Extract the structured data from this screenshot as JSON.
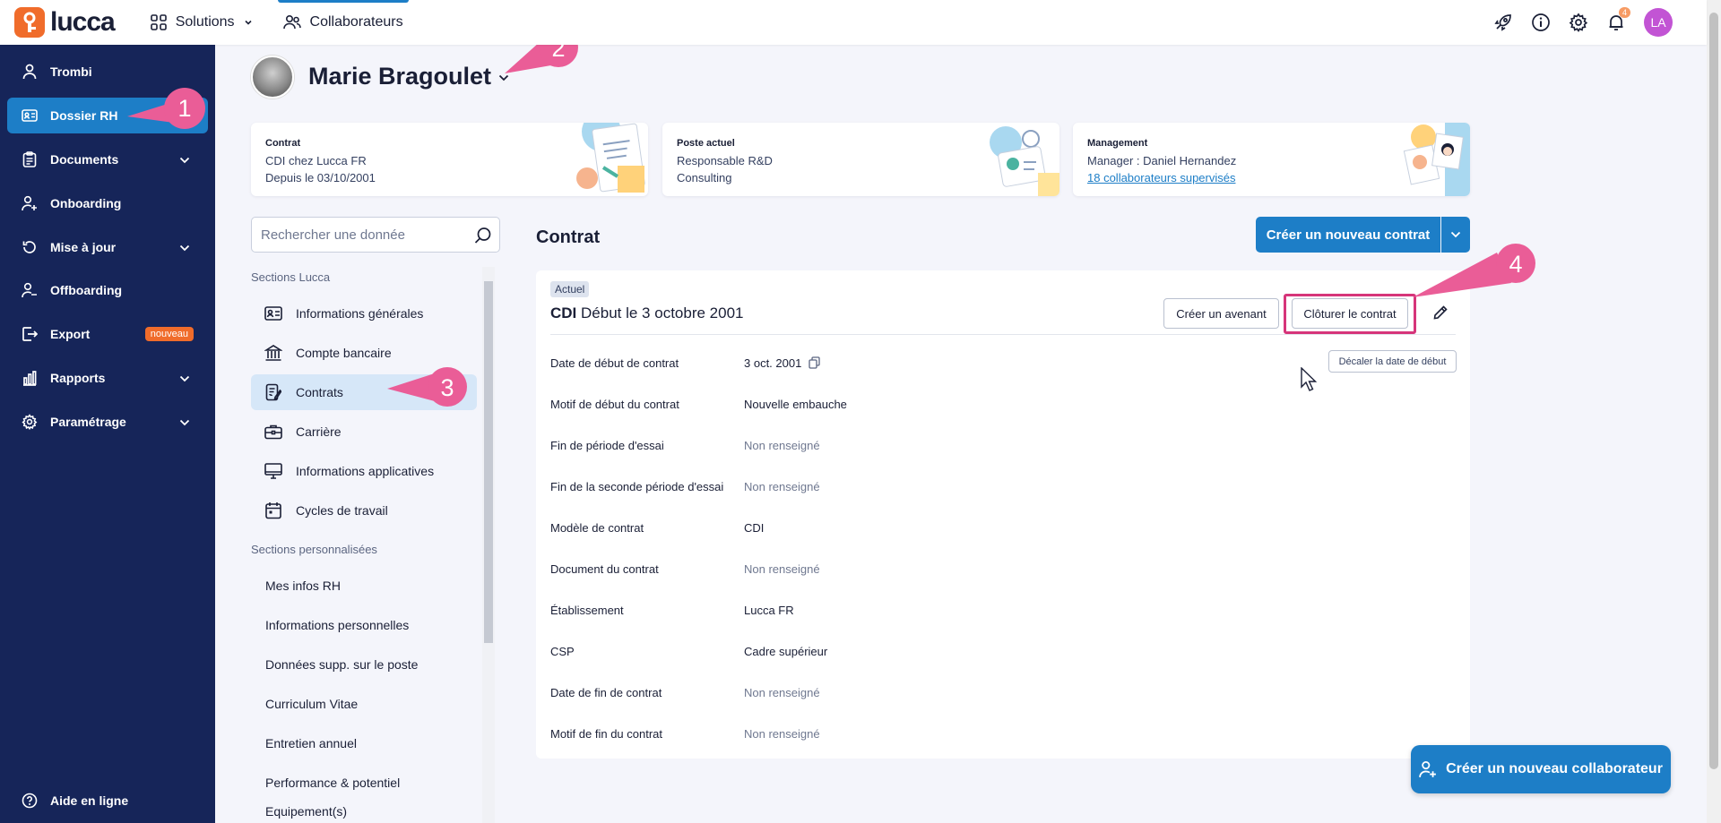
{
  "topbar": {
    "logo_text": "lucca",
    "nav": [
      {
        "label": "Solutions",
        "icon": "grid-icon"
      },
      {
        "label": "Collaborateurs",
        "icon": "people-icon"
      }
    ],
    "notification_count": "4",
    "user_initials": "LA"
  },
  "sidebar": {
    "items": [
      {
        "label": "Trombi",
        "icon": "person-icon"
      },
      {
        "label": "Dossier RH",
        "icon": "id-card-icon",
        "active": true
      },
      {
        "label": "Documents",
        "icon": "clipboard-icon",
        "expandable": true
      },
      {
        "label": "Onboarding",
        "icon": "person-plus-icon"
      },
      {
        "label": "Mise à jour",
        "icon": "refresh-icon",
        "expandable": true
      },
      {
        "label": "Offboarding",
        "icon": "person-minus-icon"
      },
      {
        "label": "Export",
        "icon": "export-icon",
        "badge": "nouveau"
      },
      {
        "label": "Rapports",
        "icon": "bar-chart-icon",
        "expandable": true
      },
      {
        "label": "Paramétrage",
        "icon": "gear-icon",
        "expandable": true
      }
    ],
    "help": "Aide en ligne"
  },
  "person": {
    "name": "Marie Bragoulet"
  },
  "cards": {
    "contrat": {
      "title": "Contrat",
      "line1": "CDI chez Lucca FR",
      "line2": "Depuis le 03/10/2001"
    },
    "poste": {
      "title": "Poste actuel",
      "line1": "Responsable R&D",
      "line2": "Consulting"
    },
    "management": {
      "title": "Management",
      "line1": "Manager : Daniel Hernandez",
      "link": "18 collaborateurs supervisés"
    }
  },
  "search": {
    "placeholder": "Rechercher une donnée"
  },
  "sections": {
    "lucca_title": "Sections Lucca",
    "lucca": [
      {
        "label": "Informations générales",
        "icon": "id-card-icon"
      },
      {
        "label": "Compte bancaire",
        "icon": "bank-icon"
      },
      {
        "label": "Contrats",
        "icon": "contract-icon",
        "active": true
      },
      {
        "label": "Carrière",
        "icon": "briefcase-icon"
      },
      {
        "label": "Informations applicatives",
        "icon": "monitor-icon"
      },
      {
        "label": "Cycles de travail",
        "icon": "calendar-icon"
      }
    ],
    "custom_title": "Sections personnalisées",
    "custom": [
      "Mes infos RH",
      "Informations personnelles",
      "Données supp. sur le poste",
      "Curriculum Vitae",
      "Entretien annuel",
      "Performance & potentiel",
      "Equipement(s)"
    ]
  },
  "contract": {
    "title": "Contrat",
    "new_contract_button": "Créer un nouveau contrat",
    "status_tag": "Actuel",
    "type": "CDI",
    "start_text": "Début le 3 octobre 2001",
    "amendment_button": "Créer un avenant",
    "close_button": "Clôturer le contrat",
    "shift_date_button": "Décaler la date de début",
    "fields": [
      {
        "label": "Date de début de contrat",
        "value": "3 oct. 2001",
        "copy": true
      },
      {
        "label": "Motif de début du contrat",
        "value": "Nouvelle embauche"
      },
      {
        "label": "Fin de période d'essai",
        "value": "Non renseigné",
        "muted": true
      },
      {
        "label": "Fin de la seconde période d'essai",
        "value": "Non renseigné",
        "muted": true
      },
      {
        "label": "Modèle de contrat",
        "value": "CDI"
      },
      {
        "label": "Document du contrat",
        "value": "Non renseigné",
        "muted": true
      },
      {
        "label": "Établissement",
        "value": "Lucca FR"
      },
      {
        "label": "CSP",
        "value": "Cadre supérieur"
      },
      {
        "label": "Date de fin de contrat",
        "value": "Non renseigné",
        "muted": true
      },
      {
        "label": "Motif de fin du contrat",
        "value": "Non renseigné",
        "muted": true
      }
    ]
  },
  "fab": {
    "label": "Créer un nouveau collaborateur"
  },
  "annotations": [
    "1",
    "2",
    "3",
    "4"
  ],
  "colors": {
    "sidebar": "#162559",
    "accent": "#1d7ec7",
    "brand": "#f06c2b",
    "annotation": "#d6357a"
  }
}
